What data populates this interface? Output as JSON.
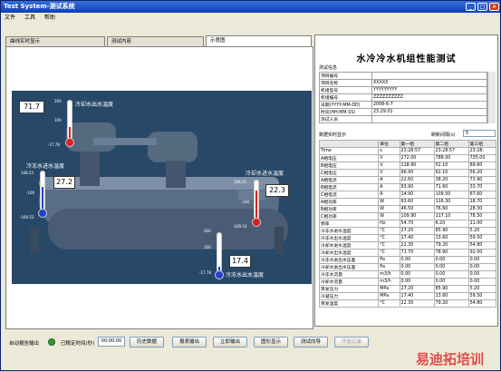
{
  "window": {
    "title": "Test System-测试系统"
  },
  "menu": [
    "文件",
    "工具",
    "帮助"
  ],
  "tabs": [
    "曲线实时显示",
    "测试内容",
    "示意图"
  ],
  "scene": {
    "top_left_value": "71.7",
    "top_left_label": "冷却水出水温度",
    "left_value": "27.2",
    "left_label": "冷冻水进水温度",
    "right_value": "22.3",
    "right_label": "冷却水进水温度",
    "bottom_value": "17.4",
    "bottom_label": "冷冻水出水温度",
    "therm_ticks": {
      "t1": [
        "260",
        "100",
        "-17.78"
      ],
      "t2": [
        "108.25",
        "-100",
        "-169.53"
      ],
      "t3": [
        "108.25",
        "-100",
        "-169.53"
      ],
      "t4": [
        "260",
        "100",
        "-17.78"
      ]
    },
    "therm_levels": {
      "t1": 0.32,
      "t2": 0.6,
      "t3": 0.74,
      "t4": 0.12
    }
  },
  "panel": {
    "title": "水冷冷水机组性能测试",
    "info_label": "测试信息",
    "info_rows": [
      [
        "项目编号",
        ""
      ],
      [
        "项目名称",
        "XXXXX"
      ],
      [
        "机组型号",
        "YYYYYYYYY"
      ],
      [
        "机组编号",
        "ZZZZZZZZZZ"
      ],
      [
        "日期(YYYY-MM-DD)",
        "2008-6-7"
      ],
      [
        "时间(HH:MM:SS)",
        "23:29:01"
      ],
      [
        "测试人员",
        ""
      ]
    ],
    "realtime_label": "数据实时显示",
    "refresh_label": "刷新间隔(s)",
    "refresh_value": "5",
    "headers": [
      "",
      "单位",
      "第一组",
      "第二组",
      "第三组"
    ],
    "rows": [
      [
        "Time",
        "s",
        "23:28:57",
        "23:28:57",
        "23:28:"
      ],
      [
        "A相电压",
        "V",
        "272.00",
        "788.00",
        "735.00"
      ],
      [
        "B相电压",
        "V",
        "118.90",
        "52.10",
        "89.60"
      ],
      [
        "C相电压",
        "V",
        "96.90",
        "62.10",
        "56.20"
      ],
      [
        "A相电流",
        "A",
        "22.60",
        "38.20",
        "73.90"
      ],
      [
        "B相电流",
        "A",
        "93.90",
        "71.60",
        "33.70"
      ],
      [
        "C相电流",
        "A",
        "14.90",
        "109.50",
        "67.60"
      ],
      [
        "A相功率",
        "W",
        "93.60",
        "116.30",
        "18.70"
      ],
      [
        "B相功率",
        "W",
        "46.50",
        "76.60",
        "28.30"
      ],
      [
        "C相功率",
        "W",
        "109.90",
        "117.10",
        "78.50"
      ],
      [
        "频率",
        "Hz",
        "54.70",
        "6.20",
        "11.00"
      ],
      [
        "冷冻水进水温度",
        "°C",
        "27.20",
        "85.90",
        "5.20"
      ],
      [
        "冷冻水出水温度",
        "°C",
        "17.40",
        "13.60",
        "59.50"
      ],
      [
        "冷却水进水温度",
        "°C",
        "22.30",
        "79.20",
        "54.80"
      ],
      [
        "冷却水出水温度",
        "°C",
        "71.70",
        "78.90",
        "92.00"
      ],
      [
        "冷冻水进出水压差",
        "Pa",
        "0.00",
        "0.00",
        "0.00"
      ],
      [
        "冷却水进出水压差",
        "Pa",
        "0.00",
        "0.00",
        "0.00"
      ],
      [
        "冷冻水流量",
        "m3/h",
        "0.00",
        "0.00",
        "0.00"
      ],
      [
        "冷却水流量",
        "m3/h",
        "0.00",
        "0.00",
        "0.00"
      ],
      [
        "蒸发压力",
        "MPa",
        "27.20",
        "85.90",
        "5.20"
      ],
      [
        "冷凝压力",
        "MPa",
        "17.40",
        "13.60",
        "59.50"
      ],
      [
        "蒸发温度",
        "°C",
        "22.30",
        "79.20",
        "54.80"
      ]
    ]
  },
  "bottom": {
    "auto_report": "自动报告输出",
    "steady_label": "已稳定时间(秒)",
    "steady_value": "00:00:00",
    "buttons": [
      "历史数据",
      "报表输出",
      "立即输出",
      "图形显示",
      "测试向导",
      "开始记录"
    ]
  },
  "watermark": "易迪拓培训"
}
